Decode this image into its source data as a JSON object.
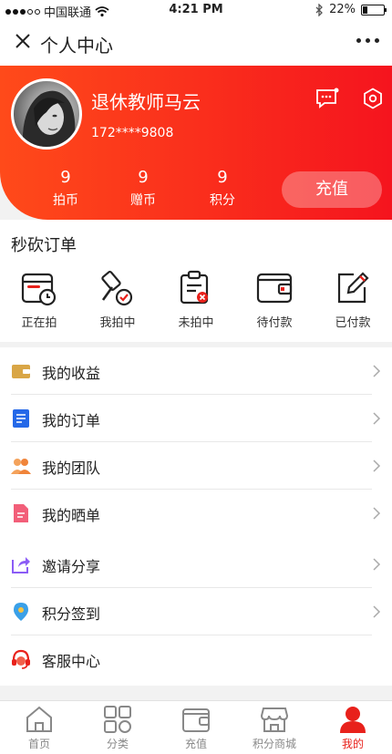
{
  "status_bar": {
    "carrier": "中国联通",
    "time": "4:21 PM",
    "battery": "22%"
  },
  "nav": {
    "title": "个人中心"
  },
  "profile": {
    "username": "退休教师马云",
    "phone": "172****9808",
    "stats": [
      {
        "value": "9",
        "label": "拍币"
      },
      {
        "value": "9",
        "label": "赠币"
      },
      {
        "value": "9",
        "label": "积分"
      }
    ],
    "recharge_label": "充值"
  },
  "orders": {
    "title": "秒砍订单",
    "items": [
      {
        "label": "正在拍",
        "icon": "calendar-clock-icon"
      },
      {
        "label": "我拍中",
        "icon": "gavel-check-icon"
      },
      {
        "label": "未拍中",
        "icon": "clipboard-x-icon"
      },
      {
        "label": "待付款",
        "icon": "wallet-icon"
      },
      {
        "label": "已付款",
        "icon": "edit-square-icon"
      }
    ]
  },
  "menu_group1": [
    {
      "label": "我的收益",
      "icon": "wallet-gold-icon"
    },
    {
      "label": "我的订单",
      "icon": "list-blue-icon"
    },
    {
      "label": "我的团队",
      "icon": "team-orange-icon"
    },
    {
      "label": "我的晒单",
      "icon": "document-pink-icon"
    }
  ],
  "menu_group2": [
    {
      "label": "邀请分享",
      "icon": "share-purple-icon"
    },
    {
      "label": "积分签到",
      "icon": "location-pin-icon"
    },
    {
      "label": "客服中心",
      "icon": "headset-icon"
    }
  ],
  "tabs": [
    {
      "label": "首页",
      "icon": "home-icon"
    },
    {
      "label": "分类",
      "icon": "grid-icon"
    },
    {
      "label": "充值",
      "icon": "wallet-icon"
    },
    {
      "label": "积分商城",
      "icon": "store-icon"
    },
    {
      "label": "我的",
      "icon": "person-icon"
    }
  ],
  "colors": {
    "accent": "#e8211b",
    "header_start": "#ff4a1a",
    "header_end": "#f5141e"
  }
}
